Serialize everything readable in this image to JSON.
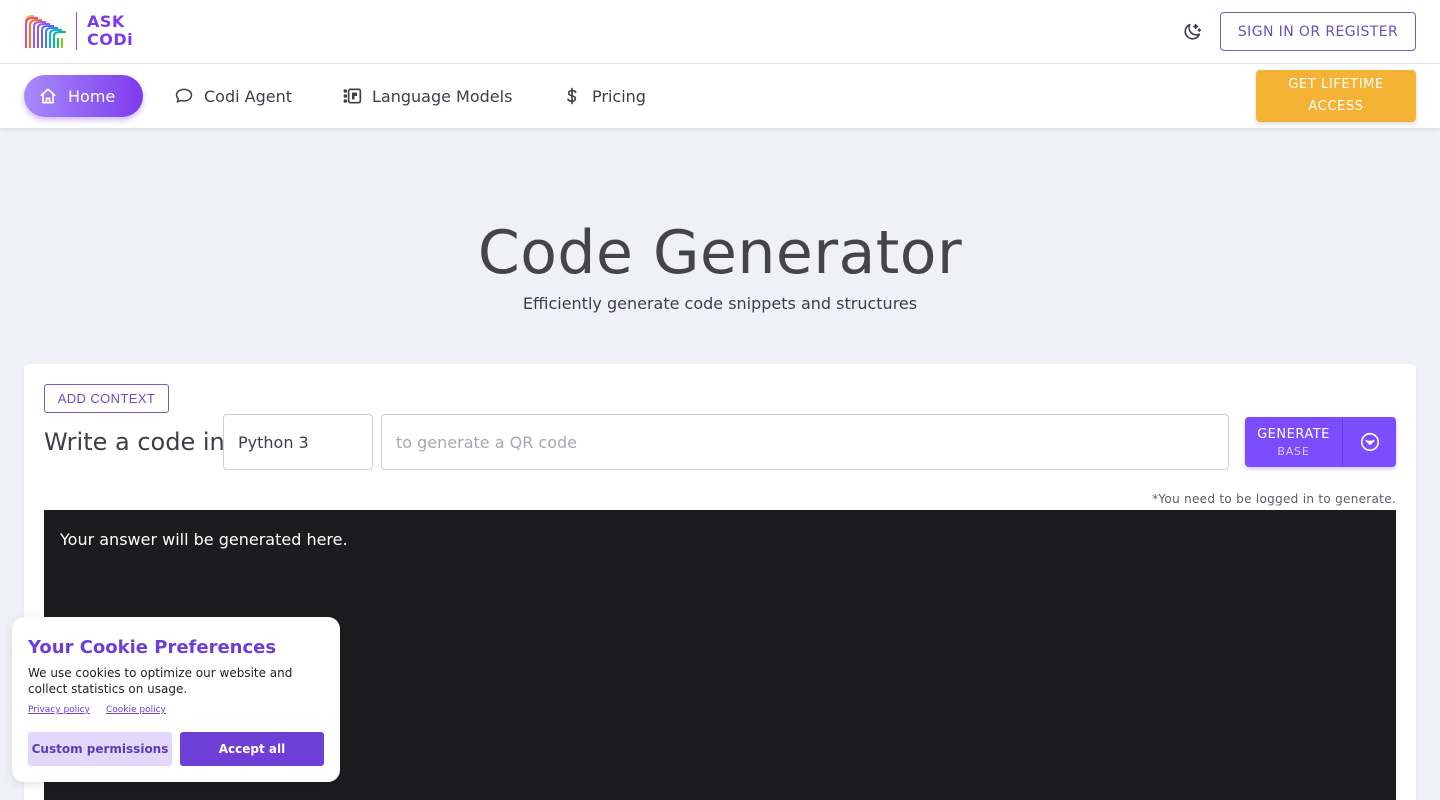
{
  "header": {
    "logo": {
      "line1": "ASK",
      "line2": "CODi"
    },
    "theme_icon": "moon-icon",
    "signin_label": "SIGN IN OR REGISTER"
  },
  "nav": {
    "items": [
      {
        "label": "Home",
        "icon": "home-icon",
        "active": true
      },
      {
        "label": "Codi Agent",
        "icon": "chat-icon",
        "active": false
      },
      {
        "label": "Language Models",
        "icon": "models-icon",
        "active": false
      },
      {
        "label": "Pricing",
        "icon": "dollar-icon",
        "active": false
      }
    ],
    "lifetime_line1": "GET LIFETIME",
    "lifetime_line2": "ACCESS"
  },
  "hero": {
    "title": "Code Generator",
    "subtitle": "Efficiently generate code snippets and structures"
  },
  "form": {
    "add_context_label": "ADD CONTEXT",
    "write_label": "Write a code in",
    "language_value": "Python 3",
    "prompt_placeholder": "to generate a QR code",
    "generate_label": "GENERATE",
    "generate_sub": "BASE",
    "login_note": "*You need to be logged in to generate.",
    "output_placeholder": "Your answer will be generated here."
  },
  "cookie": {
    "title": "Your Cookie Preferences",
    "text": "We use cookies to optimize our website and collect statistics on usage.",
    "privacy_link": "Privacy policy",
    "cookie_link": "Cookie policy",
    "custom_label": "Custom permissions",
    "accept_label": "Accept all"
  },
  "colors": {
    "accent": "#7c4dff",
    "brand_purple": "#6d3fd6",
    "lifetime_orange": "#f5b335",
    "output_bg": "#1c1c1e"
  }
}
